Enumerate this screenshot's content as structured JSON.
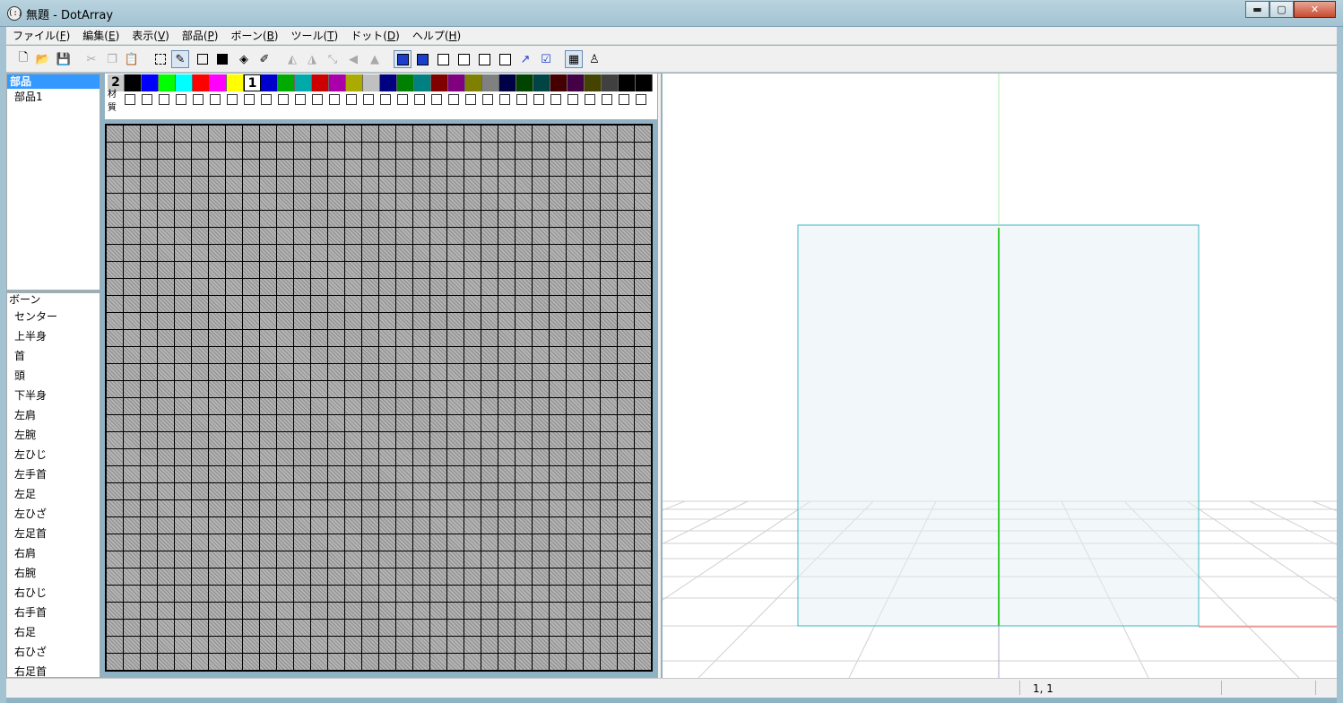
{
  "window": {
    "title": "無題 - DotArray",
    "icon_glyph": "(:)",
    "minimize": "▬",
    "maximize": "▢",
    "close": "✕"
  },
  "menu": [
    {
      "label": "ファイル(",
      "key": "F",
      "end": ")"
    },
    {
      "label": "編集(",
      "key": "E",
      "end": ")"
    },
    {
      "label": "表示(",
      "key": "V",
      "end": ")"
    },
    {
      "label": "部品(",
      "key": "P",
      "end": ")"
    },
    {
      "label": "ボーン(",
      "key": "B",
      "end": ")"
    },
    {
      "label": "ツール(",
      "key": "T",
      "end": ")"
    },
    {
      "label": "ドット(",
      "key": "D",
      "end": ")"
    },
    {
      "label": "ヘルプ(",
      "key": "H",
      "end": ")"
    }
  ],
  "toolbar_icons": [
    "new-file-icon",
    "open-folder-icon",
    "save-icon",
    "cut-icon",
    "copy-icon",
    "paste-icon",
    "select-rect-icon",
    "pencil-icon",
    "rect-outline-icon",
    "rect-fill-icon",
    "bucket-fill-icon",
    "eyedropper-icon",
    "mirror-icon",
    "mirror-left-icon",
    "rotate-icon",
    "flip-left-icon",
    "flip-up-icon",
    "view-front-icon",
    "view-back-icon",
    "view-left-icon",
    "view-right-icon",
    "view-top-icon",
    "view-bottom-icon",
    "view-perspective-icon",
    "checkbox-icon",
    "material-icon",
    "figure-icon"
  ],
  "parts": {
    "header": "部品",
    "items": [
      "部品1"
    ]
  },
  "bones": {
    "header": "ボーン",
    "items": [
      "センター",
      "上半身",
      "首",
      "頭",
      "下半身",
      "左肩",
      "左腕",
      "左ひじ",
      "左手首",
      "左足",
      "左ひざ",
      "左足首",
      "右肩",
      "右腕",
      "右ひじ",
      "右手首",
      "右足",
      "右ひざ",
      "右足首"
    ]
  },
  "palette": {
    "left_index": "2",
    "right_index": "1",
    "colors": [
      "#000000",
      "#0000ff",
      "#00ff00",
      "#00ffff",
      "#ff0000",
      "#ff00ff",
      "#ffff00",
      "#ffffff",
      "#0000cc",
      "#00aa00",
      "#00aaaa",
      "#cc0000",
      "#aa00aa",
      "#aaaa00",
      "#c0c0c0",
      "#000080",
      "#008000",
      "#008080",
      "#800000",
      "#800080",
      "#808000",
      "#808080",
      "#000044",
      "#004400",
      "#004444",
      "#440000",
      "#440044",
      "#444400",
      "#404040",
      "#000000",
      "#000000"
    ],
    "material_label": "材質",
    "material_count": 31
  },
  "grid": {
    "cols": 32,
    "rows": 32
  },
  "status": {
    "coords": "1, 1"
  }
}
